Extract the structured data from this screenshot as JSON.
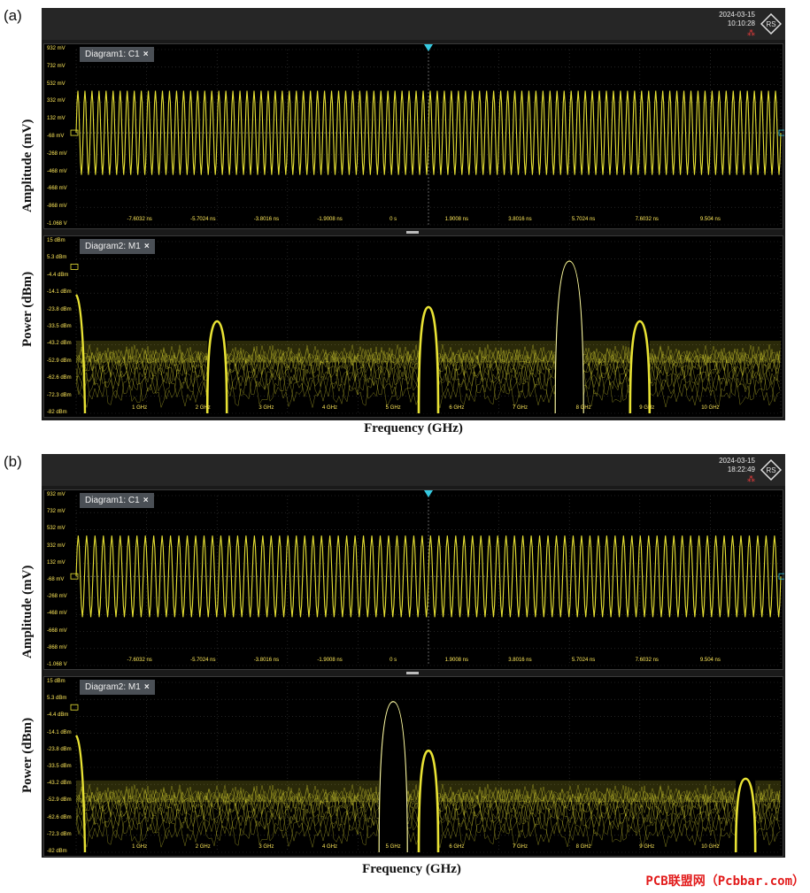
{
  "panels": [
    {
      "label": "(a)",
      "date": "2024-03-15",
      "time": "10:10:28",
      "time_diagram": {
        "title": "Diagram1: C1",
        "close": "×",
        "y_ticks": [
          "932 mV",
          "732 mV",
          "532 mV",
          "332 mV",
          "132 mV",
          "-68 mV",
          "-268 mV",
          "-468 mV",
          "-668 mV",
          "-868 mV",
          "-1.068 V"
        ],
        "x_ticks": [
          "-7.6032 ns",
          "-5.7024 ns",
          "-3.8016 ns",
          "-1.9008 ns",
          "0 s",
          "1.9008 ns",
          "3.8016 ns",
          "5.7024 ns",
          "7.6032 ns",
          "9.504 ns"
        ],
        "ylabel": "Amplitude (mV)",
        "cycles": 100
      },
      "spectrum_diagram": {
        "title": "Diagram2: M1",
        "close": "×",
        "y_ticks": [
          "15 dBm",
          "5.3 dBm",
          "-4.4 dBm",
          "-14.1 dBm",
          "-23.8 dBm",
          "-33.5 dBm",
          "-43.2 dBm",
          "-52.9 dBm",
          "-62.6 dBm",
          "-72.3 dBm",
          "-82 dBm"
        ],
        "x_ticks": [
          "1 GHz",
          "2 GHz",
          "3 GHz",
          "4 GHz",
          "5 GHz",
          "6 GHz",
          "7 GHz",
          "8 GHz",
          "9 GHz",
          "10 GHz"
        ],
        "ylabel": "Power (dBm)",
        "xlabel": "Frequency (GHz)",
        "peaks": [
          {
            "freq_ghz": 2.0,
            "power_dbm": -30
          },
          {
            "freq_ghz": 5.0,
            "power_dbm": -22
          },
          {
            "freq_ghz": 7.0,
            "power_dbm": 4
          },
          {
            "freq_ghz": 8.0,
            "power_dbm": -30
          }
        ],
        "noise_floor_dbm": -41,
        "dc_edge": true
      }
    },
    {
      "label": "(b)",
      "date": "2024-03-15",
      "time": "18:22:49",
      "time_diagram": {
        "title": "Diagram1: C1",
        "close": "×",
        "y_ticks": [
          "932 mV",
          "732 mV",
          "532 mV",
          "332 mV",
          "132 mV",
          "-68 mV",
          "-268 mV",
          "-468 mV",
          "-668 mV",
          "-868 mV",
          "-1.068 V"
        ],
        "x_ticks": [
          "-7.6032 ns",
          "-5.7024 ns",
          "-3.8016 ns",
          "-1.9008 ns",
          "0 s",
          "1.9008 ns",
          "3.8016 ns",
          "5.7024 ns",
          "7.6032 ns",
          "9.504 ns"
        ],
        "ylabel": "Amplitude (mV)",
        "cycles": 84
      },
      "spectrum_diagram": {
        "title": "Diagram2: M1",
        "close": "×",
        "y_ticks": [
          "15 dBm",
          "5.3 dBm",
          "-4.4 dBm",
          "-14.1 dBm",
          "-23.8 dBm",
          "-33.5 dBm",
          "-43.2 dBm",
          "-52.9 dBm",
          "-62.6 dBm",
          "-72.3 dBm",
          "-82 dBm"
        ],
        "x_ticks": [
          "1 GHz",
          "2 GHz",
          "3 GHz",
          "4 GHz",
          "5 GHz",
          "6 GHz",
          "7 GHz",
          "8 GHz",
          "9 GHz",
          "10 GHz"
        ],
        "ylabel": "Power (dBm)",
        "xlabel": "Frequency (GHz)",
        "peaks": [
          {
            "freq_ghz": 4.5,
            "power_dbm": 4
          },
          {
            "freq_ghz": 5.0,
            "power_dbm": -24
          },
          {
            "freq_ghz": 9.5,
            "power_dbm": -40
          }
        ],
        "noise_floor_dbm": -41,
        "dc_edge": true
      }
    }
  ],
  "watermark": "PCB联盟网（Pcbbar.com）",
  "colors": {
    "trace": "#e8e234",
    "marker": "#35c9e0",
    "grid": "#3b3b3b",
    "background": "#000000"
  }
}
